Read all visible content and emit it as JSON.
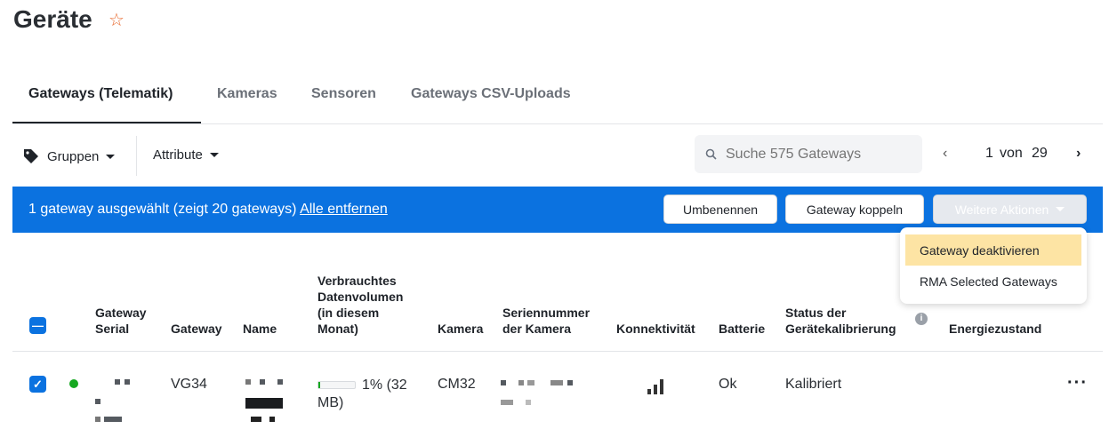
{
  "page": {
    "title": "Geräte",
    "favorite_icon": "star-icon"
  },
  "tabs": [
    {
      "label": "Gateways (Telematik)",
      "active": true
    },
    {
      "label": "Kameras"
    },
    {
      "label": "Sensoren"
    },
    {
      "label": "Gateways CSV-Uploads"
    }
  ],
  "toolbar": {
    "groups_label": "Gruppen",
    "attributes_label": "Attribute",
    "search_placeholder": "Suche 575 Gateways",
    "page_current": "1",
    "page_of": "von",
    "page_total": "29"
  },
  "selection_bar": {
    "text": "1 gateway ausgewählt (zeigt 20 gateways)",
    "clear_link": "Alle entfernen",
    "rename": "Umbenennen",
    "pair": "Gateway koppeln",
    "more_actions": "Weitere Aktionen",
    "color": "#0b72e0"
  },
  "more_menu": [
    {
      "label": "Gateway deaktivieren",
      "highlighted": true
    },
    {
      "label": "RMA Selected Gateways"
    }
  ],
  "table": {
    "headers": {
      "serial": "Gateway Serial",
      "gateway": "Gateway",
      "name": "Name",
      "data_volume": "Verbrauchtes Datenvolumen (in diesem Monat)",
      "camera": "Kamera",
      "camera_serial": "Seriennummer der Kamera",
      "connectivity": "Konnektivität",
      "battery": "Batterie",
      "calibration": "Status der Gerätekalibrierung",
      "energy": "Energiezustand"
    },
    "rows": [
      {
        "selected": true,
        "status_color": "#16a821",
        "gateway": "VG34",
        "data_volume_percent": 1,
        "data_volume_text": "1% (32 MB)",
        "camera": "CM32",
        "connectivity_icon": "signal-bars-icon",
        "battery": "Ok",
        "calibration": "Kalibriert"
      }
    ]
  }
}
